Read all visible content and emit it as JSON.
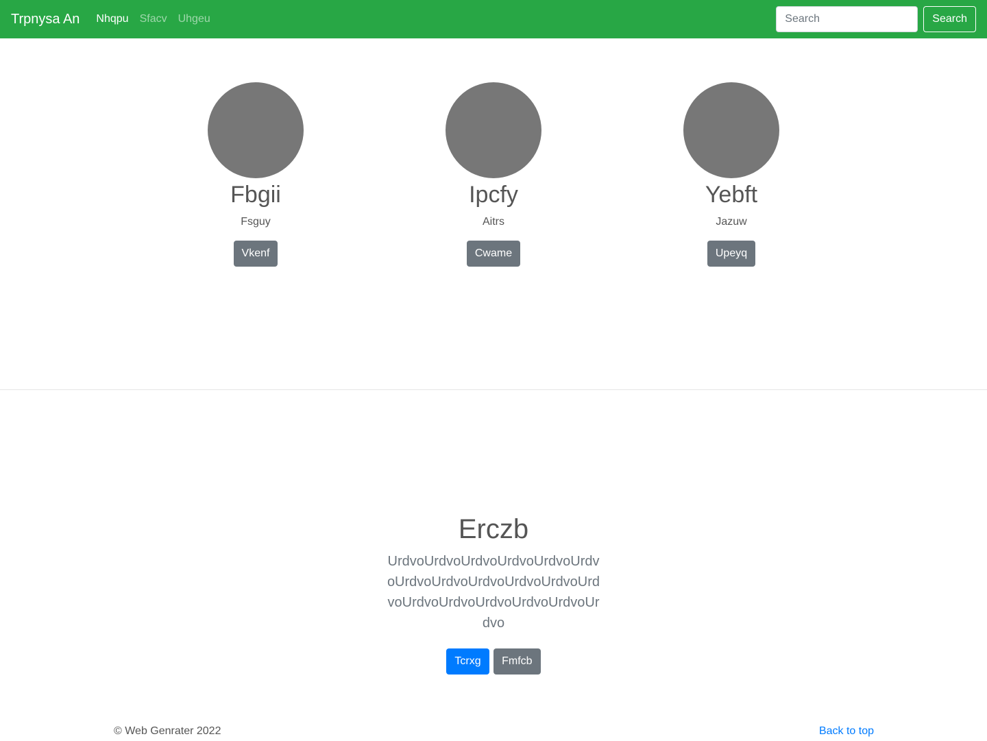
{
  "navbar": {
    "brand": "Trpnysa An",
    "links": [
      {
        "label": "Nhqpu",
        "active": true
      },
      {
        "label": "Sfacv",
        "active": false
      },
      {
        "label": "Uhgeu",
        "active": false
      }
    ],
    "search": {
      "placeholder": "Search",
      "button_label": "Search"
    },
    "background_color": "#28a745"
  },
  "people": [
    {
      "name": "Fbgii",
      "role": "Fsguy",
      "button_label": "Vkenf"
    },
    {
      "name": "Ipcfy",
      "role": "Aitrs",
      "button_label": "Cwame"
    },
    {
      "name": "Yebft",
      "role": "Jazuw",
      "button_label": "Upeyq"
    }
  ],
  "hero": {
    "heading": "Erczb",
    "lead": "UrdvoUrdvoUrdvoUrdvoUrdvoUrdvoUrdvoUrdvoUrdvoUrdvoUrdvoUrdvoUrdvoUrdvoUrdvoUrdvoUrdvoUrdvo",
    "primary_button": "Tcrxg",
    "secondary_button": "Fmfcb"
  },
  "footer": {
    "copyright": "© Web Genrater 2022",
    "back_to_top": "Back to top"
  }
}
